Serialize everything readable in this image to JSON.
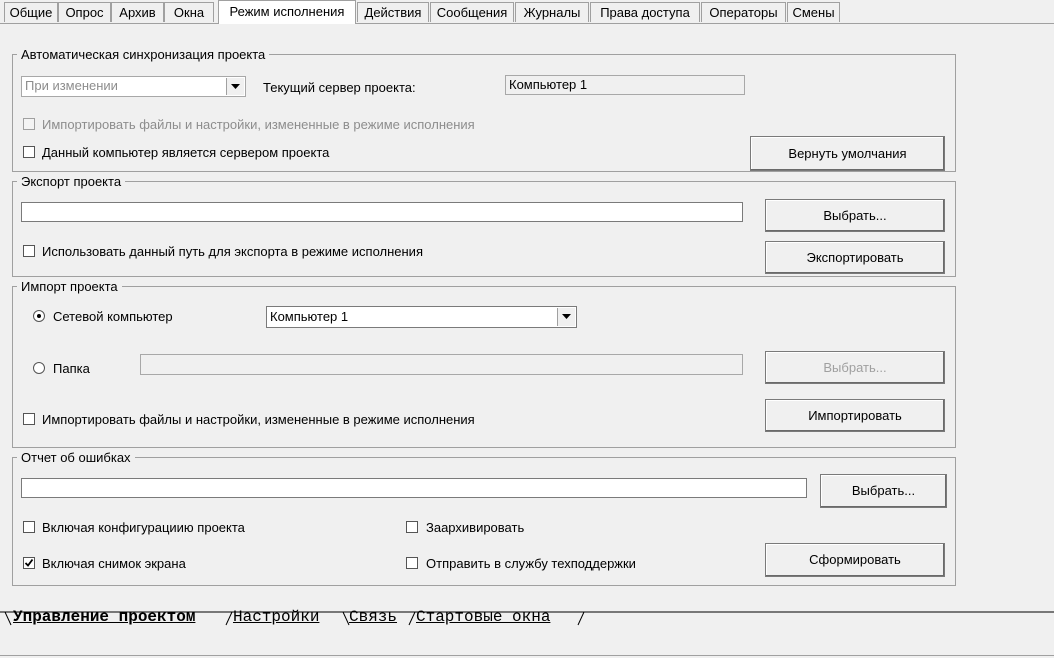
{
  "top_tabs": [
    "Общие",
    "Опрос",
    "Архив",
    "Окна",
    "Режим исполнения",
    "Действия",
    "Сообщения",
    "Журналы",
    "Права доступа",
    "Операторы",
    "Смены"
  ],
  "active_top_tab": "Режим исполнения",
  "auto_sync": {
    "title": "Автоматическая синхронизация проекта",
    "mode_value": "При изменении",
    "server_label": "Текущий сервер проекта:",
    "server_value": "Компьютер 1",
    "import_changed_label": "Импортировать файлы и настройки, измененные в режиме исполнения",
    "import_changed_checked": false,
    "is_server_label": "Данный компьютер является сервером проекта",
    "is_server_checked": false,
    "defaults_button": "Вернуть умолчания"
  },
  "export": {
    "title": "Экспорт проекта",
    "path_value": "",
    "choose_button": "Выбрать...",
    "use_path_label": "Использовать данный путь для экспорта в режиме исполнения",
    "use_path_checked": false,
    "export_button": "Экспортировать"
  },
  "import": {
    "title": "Импорт проекта",
    "network_label": "Сетевой компьютер",
    "network_selected": true,
    "network_value": "Компьютер 1",
    "folder_label": "Папка",
    "folder_value": "",
    "choose_button": "Выбрать...",
    "import_changed_label": "Импортировать файлы и настройки, измененные в режиме исполнения",
    "import_changed_checked": false,
    "import_button": "Импортировать"
  },
  "error_report": {
    "title": "Отчет об ошибках",
    "path_value": "",
    "choose_button": "Выбрать...",
    "include_config_label": "Включая конфигурациию проекта",
    "include_config_checked": false,
    "archive_label": "Заархивировать",
    "archive_checked": false,
    "include_screenshot_label": "Включая снимок экрана",
    "include_screenshot_checked": true,
    "send_support_label": "Отправить в службу техподдержки",
    "send_support_checked": false,
    "generate_button": "Сформировать"
  },
  "bottom_tabs": [
    "Управление проектом",
    "Настройки",
    "Связь",
    "Стартовые окна"
  ],
  "active_bottom_tab": "Управление проектом"
}
